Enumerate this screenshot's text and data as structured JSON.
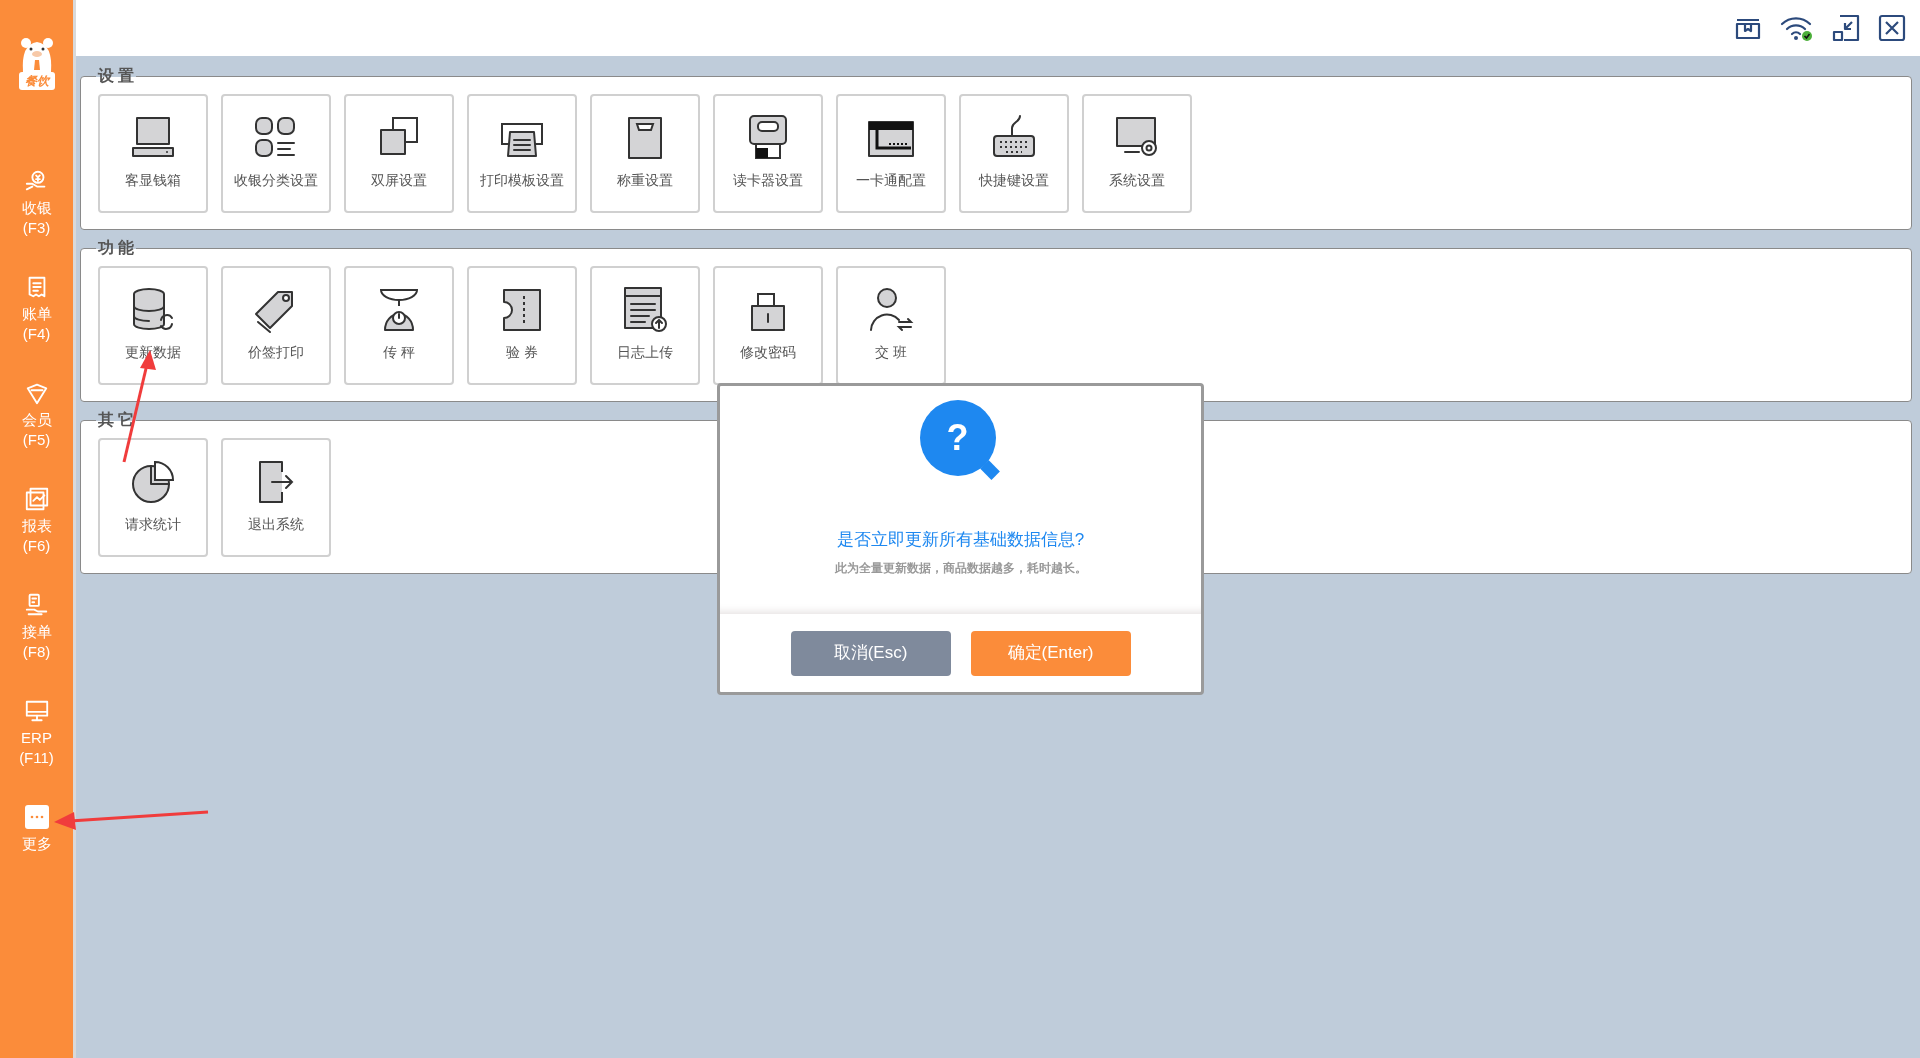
{
  "sidebar": {
    "logo_badge": "餐饮",
    "items": [
      {
        "label": "收银",
        "shortcut": "(F3)"
      },
      {
        "label": "账单",
        "shortcut": "(F4)"
      },
      {
        "label": "会员",
        "shortcut": "(F5)"
      },
      {
        "label": "报表",
        "shortcut": "(F6)"
      },
      {
        "label": "接单",
        "shortcut": "(F8)"
      },
      {
        "label": "ERP",
        "shortcut": "(F11)"
      },
      {
        "label": "更多"
      }
    ]
  },
  "sections": [
    {
      "title": "设 置",
      "tiles": [
        "客显钱箱",
        "收银分类设置",
        "双屏设置",
        "打印模板设置",
        "称重设置",
        "读卡器设置",
        "一卡通配置",
        "快捷键设置",
        "系统设置"
      ]
    },
    {
      "title": "功 能",
      "tiles": [
        "更新数据",
        "价签打印",
        "传 秤",
        "验 券",
        "日志上传",
        "修改密码",
        "交 班"
      ]
    },
    {
      "title": "其 它",
      "tiles": [
        "请求统计",
        "退出系统"
      ]
    }
  ],
  "dialog": {
    "icon": "?",
    "title": "是否立即更新所有基础数据信息?",
    "message": "此为全量更新数据，商品数据越多，耗时越长。",
    "buttons": [
      {
        "label": "取消(Esc)",
        "kind": "cancel"
      },
      {
        "label": "确定(Enter)",
        "kind": "confirm"
      }
    ]
  }
}
